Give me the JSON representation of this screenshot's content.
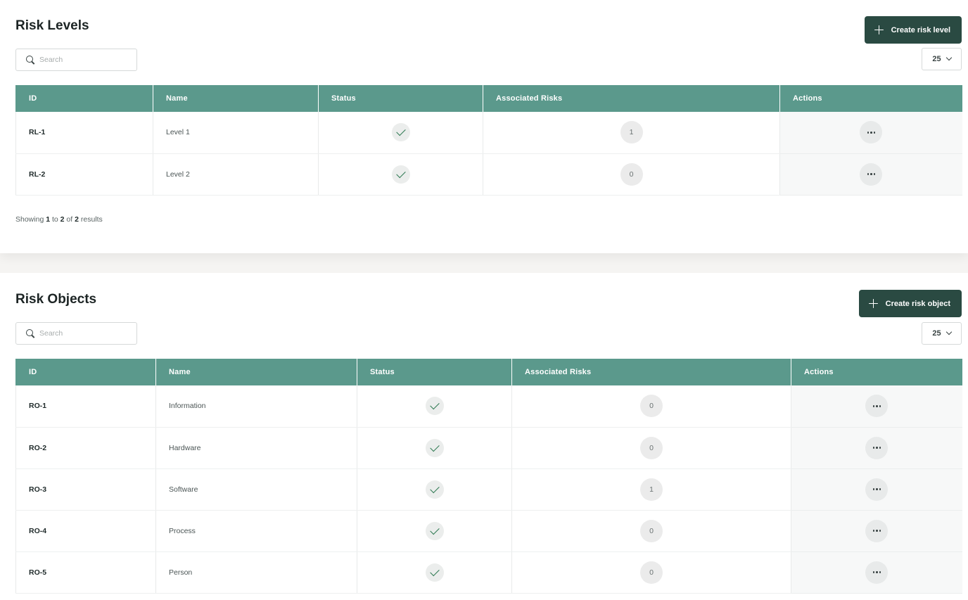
{
  "risk_levels": {
    "title": "Risk Levels",
    "create_label": "Create risk level",
    "search_placeholder": "Search",
    "page_size": "25",
    "columns": [
      "ID",
      "Name",
      "Status",
      "Associated Risks",
      "Actions"
    ],
    "rows": [
      {
        "id": "RL-1",
        "name": "Level 1",
        "status": "active",
        "associated": "1"
      },
      {
        "id": "RL-2",
        "name": "Level 2",
        "status": "active",
        "associated": "0"
      }
    ],
    "pagination": {
      "prefix": "Showing",
      "from": "1",
      "to_word": "to",
      "to": "2",
      "of_word": "of",
      "total": "2",
      "suffix": "results"
    }
  },
  "risk_objects": {
    "title": "Risk Objects",
    "create_label": "Create risk object",
    "search_placeholder": "Search",
    "page_size": "25",
    "columns": [
      "ID",
      "Name",
      "Status",
      "Associated Risks",
      "Actions"
    ],
    "rows": [
      {
        "id": "RO-1",
        "name": "Information",
        "status": "active",
        "associated": "0"
      },
      {
        "id": "RO-2",
        "name": "Hardware",
        "status": "active",
        "associated": "0"
      },
      {
        "id": "RO-3",
        "name": "Software",
        "status": "active",
        "associated": "1"
      },
      {
        "id": "RO-4",
        "name": "Process",
        "status": "active",
        "associated": "0"
      },
      {
        "id": "RO-5",
        "name": "Person",
        "status": "active",
        "associated": "0"
      }
    ]
  },
  "colors": {
    "header_bg": "#5b998c",
    "button_bg": "#2a4a42",
    "check": "#2f7a52"
  },
  "icons": [
    "search-icon",
    "plus-icon",
    "chevron-down-icon",
    "check-icon",
    "more-icon"
  ]
}
